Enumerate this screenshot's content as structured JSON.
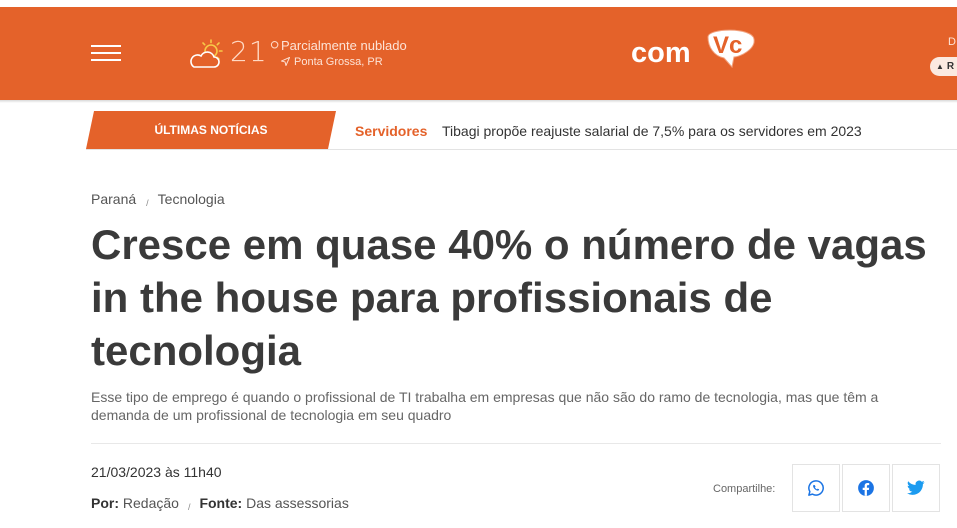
{
  "header": {
    "menu_label": "",
    "temperature": "21°",
    "weather_desc": "Parcialmente nublado",
    "location": "Ponta Grossa, PR",
    "logo_text": "comVc",
    "right_letter": "D",
    "right_pill": "R"
  },
  "ticker": {
    "label": "ÚLTIMAS NOTÍCIAS",
    "category": "Servidores",
    "headline": "Tibagi propõe reajuste salarial de 7,5% para os servidores em 2023"
  },
  "breadcrumb": {
    "items": [
      "Paraná",
      "Tecnologia"
    ],
    "separator": "/"
  },
  "article": {
    "title": "Cresce em quase 40% o número de vagas in the house para profissionais de tecnologia",
    "subtitle": "Esse tipo de emprego é quando o profissional de TI trabalha em empresas que não são do ramo de tecnologia, mas que têm a demanda de um profissional de tecnologia em seu quadro",
    "date": "21/03/2023 às 11h40",
    "by_label": "Por:",
    "by_value": "Redação",
    "source_label": "Fonte:",
    "source_value": "Das assessorias"
  },
  "share": {
    "label": "Compartilhe:",
    "buttons": [
      "whatsapp-icon",
      "facebook-icon",
      "twitter-icon"
    ]
  },
  "colors": {
    "brand_orange": "#e4622a",
    "title_text": "#3a3a3a",
    "share_blue": "#1b74e4"
  }
}
